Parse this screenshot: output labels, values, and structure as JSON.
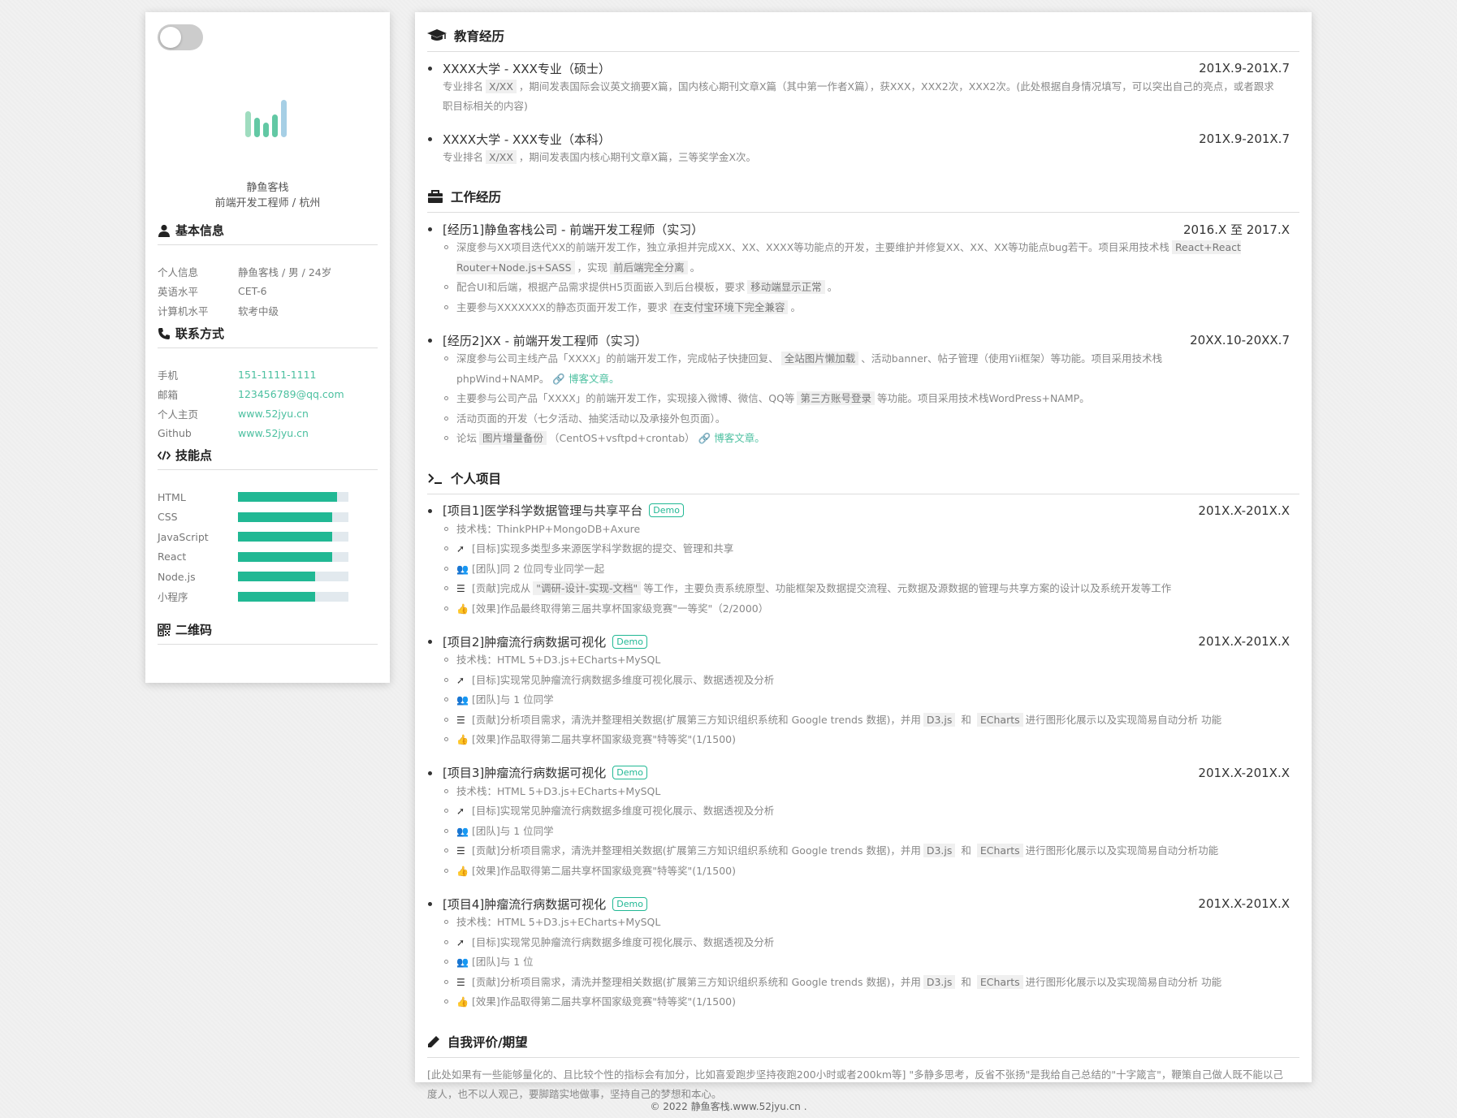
{
  "profile": {
    "name": "静鱼客栈",
    "title": "前端开发工程师 / 杭州"
  },
  "basic_info": {
    "heading": "基本信息",
    "rows": [
      {
        "key": "个人信息",
        "value": "静鱼客栈 / 男 / 24岁"
      },
      {
        "key": "英语水平",
        "value": "CET-6"
      },
      {
        "key": "计算机水平",
        "value": "软考中级"
      }
    ]
  },
  "contact": {
    "heading": "联系方式",
    "rows": [
      {
        "key": "手机",
        "value": "151-1111-1111"
      },
      {
        "key": "邮箱",
        "value": "123456789@qq.com"
      },
      {
        "key": "个人主页",
        "value": "www.52jyu.cn"
      },
      {
        "key": "Github",
        "value": "www.52jyu.cn"
      }
    ]
  },
  "skills": {
    "heading": "技能点",
    "items": [
      {
        "name": "HTML",
        "level": 0.9
      },
      {
        "name": "CSS",
        "level": 0.85
      },
      {
        "name": "JavaScript",
        "level": 0.85
      },
      {
        "name": "React",
        "level": 0.85
      },
      {
        "name": "Node.js",
        "level": 0.7
      },
      {
        "name": "小程序",
        "level": 0.7
      }
    ],
    "bar_color": "#21b894"
  },
  "qrcode": {
    "heading": "二维码"
  },
  "education": {
    "heading": "教育经历",
    "items": [
      {
        "title": "XXXX大学 - XXX专业（硕士）",
        "date": "201X.9-201X.7",
        "desc_pre": "专业排名",
        "desc_hl": "X/XX",
        "desc_post": "，期间发表国际会议英文摘要X篇，国内核心期刊文章X篇（其中第一作者X篇），获XXX，XXX2次，XXX2次。(此处根据自身情况填写，可以突出自己的亮点，或者跟求职目标相关的内容)"
      },
      {
        "title": "XXXX大学 - XXX专业（本科）",
        "date": "201X.9-201X.7",
        "desc_pre": "专业排名",
        "desc_hl": "X/XX",
        "desc_post": "，期间发表国内核心期刊文章X篇，三等奖学金X次。"
      }
    ]
  },
  "work": {
    "heading": "工作经历",
    "items": [
      {
        "title": "[经历1]静鱼客栈公司 - 前端开发工程师（实习）",
        "date": "2016.X 至 2017.X",
        "subs": [
          {
            "t1": "深度参与XX项目迭代XX的前端开发工作，独立承担并完成XX、XX、XXXX等功能点的开发，主要维护并修复XX、XX、XX等功能点bug若干。项目采用技术栈",
            "hl1": "React+React Router+Node.js+SASS",
            "t2": "，实现",
            "hl2": "前后端完全分离",
            "t3": "。"
          },
          {
            "t1": "配合UI和后端，根据产品需求提供H5页面嵌入到后台模板，要求",
            "hl1": "移动端显示正常",
            "t2": "。"
          },
          {
            "t1": "主要参与XXXXXXX的静态页面开发工作，要求",
            "hl1": "在支付宝环境下完全兼容",
            "t2": "。"
          }
        ]
      },
      {
        "title": "[经历2]XX - 前端开发工程师（实习）",
        "date": "20XX.10-20XX.7",
        "subs": [
          {
            "t1": "深度参与公司主线产品「XXXX」的前端开发工作，完成帖子快捷回复、",
            "hl1": "全站图片懒加载",
            "t2": "、活动banner、帖子管理（使用Yii框架）等功能。项目采用技术栈 phpWind+NAMP。",
            "link": "博客文章。"
          },
          {
            "t1": "主要参与公司产品「XXXX」的前端开发工作，实现接入微博、微信、QQ等",
            "hl1": "第三方账号登录",
            "t2": "等功能。项目采用技术栈WordPress+NAMP。"
          },
          {
            "t1": "活动页面的开发（七夕活动、抽奖活动以及承接外包页面）。"
          },
          {
            "t1": "论坛",
            "hl1": "图片增量备份",
            "t2": "（CentOS+vsftpd+crontab）",
            "link": "博客文章。"
          }
        ]
      }
    ]
  },
  "projects": {
    "heading": "个人项目",
    "demo_label": "Demo",
    "items": [
      {
        "title": "[项目1]医学科学数据管理与共享平台",
        "date": "201X.X-201X.X",
        "stack": "技术栈：ThinkPHP+MongoDB+Axure",
        "goal": "[目标]实现多类型多来源医学科学数据的提交、管理和共享",
        "team": "[团队]同 2 位同专业同学一起",
        "contrib_pre": "[贡献]完成从",
        "contrib_hl": "\"调研-设计-实现-文档\"",
        "contrib_post": "等工作，主要负责系统原型、功能框架及数据提交流程、元数据及源数据的管理与共享方案的设计以及系统开发等工作",
        "effect": "[效果]作品最终取得第三届共享杯国家级竞赛\"一等奖\"（2/2000）"
      },
      {
        "title": "[项目2]肿瘤流行病数据可视化",
        "date": "201X.X-201X.X",
        "stack": "技术栈：HTML 5+D3.js+ECharts+MySQL",
        "goal": "[目标]实现常见肿瘤流行病数据多维度可视化展示、数据透视及分析",
        "team": "[团队]与 1 位同学",
        "contrib_pre": "[贡献]分析项目需求，清洗并整理相关数据(扩展第三方知识组织系统和 Google trends 数据)，并用",
        "hl_a": "D3.js",
        "mid": "和",
        "hl_b": "ECharts",
        "contrib_post": "进行图形化展示以及实现简易自动分析 功能",
        "effect": "[效果]作品取得第二届共享杯国家级竞赛\"特等奖\"(1/1500)"
      },
      {
        "title": "[项目3]肿瘤流行病数据可视化",
        "date": "201X.X-201X.X",
        "stack": "技术栈：HTML 5+D3.js+ECharts+MySQL",
        "goal": "[目标]实现常见肿瘤流行病数据多维度可视化展示、数据透视及分析",
        "team": "[团队]与 1 位同学",
        "contrib_pre": "[贡献]分析项目需求，清洗并整理相关数据(扩展第三方知识组织系统和 Google trends 数据)，并用",
        "hl_a": "D3.js",
        "mid": "和",
        "hl_b": "ECharts",
        "contrib_post": "进行图形化展示以及实现简易自动分析功能",
        "effect": "[效果]作品取得第二届共享杯国家级竞赛\"特等奖\"(1/1500)"
      },
      {
        "title": "[项目4]肿瘤流行病数据可视化",
        "date": "201X.X-201X.X",
        "stack": "技术栈：HTML 5+D3.js+ECharts+MySQL",
        "goal": "[目标]实现常见肿瘤流行病数据多维度可视化展示、数据透视及分析",
        "team": "[团队]与 1 位",
        "contrib_pre": "[贡献]分析项目需求，清洗并整理相关数据(扩展第三方知识组织系统和 Google trends 数据)，并用",
        "hl_a": "D3.js",
        "mid": "和",
        "hl_b": "ECharts",
        "contrib_post": "进行图形化展示以及实现简易自动分析 功能",
        "effect": "[效果]作品取得第二届共享杯国家级竞赛\"特等奖\"(1/1500)"
      }
    ]
  },
  "self_eval": {
    "heading": "自我评价/期望",
    "text": "[此处如果有一些能够量化的、且比较个性的指标会有加分，比如喜爱跑步坚持夜跑200小时或者200km等] \"多静多思考，反省不张扬\"是我给自己总结的\"十字箴言\"，鞭策自己做人既不能以己度人，也不以人观己，要脚踏实地做事，坚持自己的梦想和本心。"
  },
  "footer": "© 2022 静鱼客栈.www.52jyu.cn .",
  "colors": {
    "accent": "#21b894",
    "link": "#4cc0a0",
    "logo_a": "#8fd9b6",
    "logo_b": "#5fc7a6",
    "logo_c": "#9ec9e3"
  }
}
